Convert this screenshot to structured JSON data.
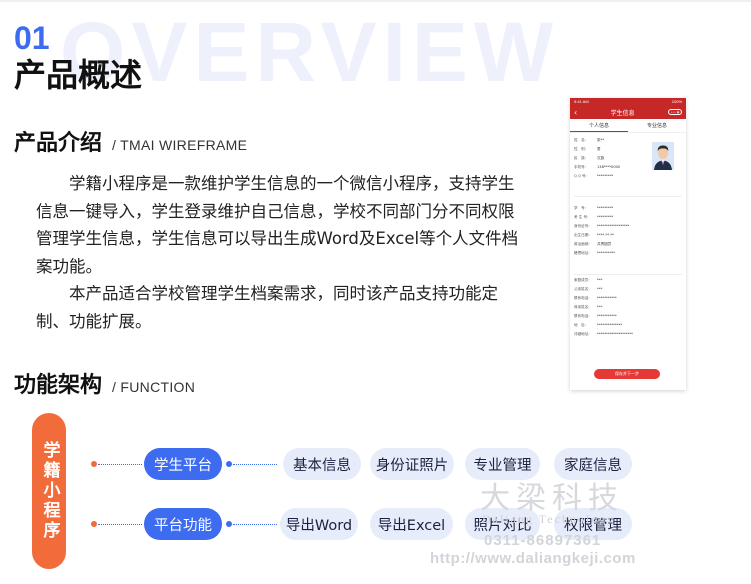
{
  "header": {
    "bg_word": "OVERVIEW",
    "number": "01",
    "title": "产品概述"
  },
  "intro_section": {
    "title": "产品介绍",
    "subtitle": "/ TMAI WIREFRAME",
    "paragraphs": [
      "学籍小程序是一款维护学生信息的一个微信小程序，支持学生信息一键导入，学生登录维护自己信息，学校不同部门分不同权限管理学生信息，学生信息可以导出生成Word及Excel等个人文件档案功能。",
      "本产品适合学校管理学生档案需求，同时该产品支持功能定制、功能扩展。"
    ]
  },
  "phone_mockup": {
    "status_time": "9:41 AM",
    "status_battery": "100%",
    "nav_title": "学生信息",
    "tabs": [
      "个人信息",
      "专业信息"
    ],
    "rows": [
      {
        "k": "姓　名:",
        "v": "张**"
      },
      {
        "k": "性　别:",
        "v": "男"
      },
      {
        "k": "民　族:",
        "v": "汉族"
      },
      {
        "k": "手机号:",
        "v": "138****0000"
      },
      {
        "k": "Q Q 号:",
        "v": "*********"
      },
      {
        "k": "学　号:",
        "v": "*********"
      },
      {
        "k": "考 生 号:",
        "v": "*********"
      },
      {
        "k": "身份证号:",
        "v": "******************"
      },
      {
        "k": "出生日期:",
        "v": "****-**-**"
      },
      {
        "k": "政治面貌:",
        "v": "共青团员"
      },
      {
        "k": "籍贯地址:",
        "v": "**********"
      },
      {
        "k": "家庭成员:",
        "v": "***"
      },
      {
        "k": "父亲姓名:",
        "v": "***"
      },
      {
        "k": "联系电话:",
        "v": "***********"
      },
      {
        "k": "母亲姓名:",
        "v": "***"
      },
      {
        "k": "联系电话:",
        "v": "***********"
      },
      {
        "k": "地　址:",
        "v": "**************"
      },
      {
        "k": "详细地址:",
        "v": "********************"
      }
    ],
    "button": "保存并下一步"
  },
  "function_section": {
    "title": "功能架构",
    "subtitle": "/ FUNCTION",
    "root": "学籍小程序",
    "rows": [
      {
        "primary": "学生平台",
        "items": [
          "基本信息",
          "身份证照片",
          "专业管理",
          "家庭信息"
        ]
      },
      {
        "primary": "平台功能",
        "items": [
          "导出Word",
          "导出Excel",
          "照片对比",
          "权限管理"
        ]
      }
    ]
  },
  "watermark": {
    "cn": "大梁科技",
    "en": "Daliang Technology",
    "phone": "0311-86897361",
    "url": "http://www.daliangkeji.com"
  }
}
